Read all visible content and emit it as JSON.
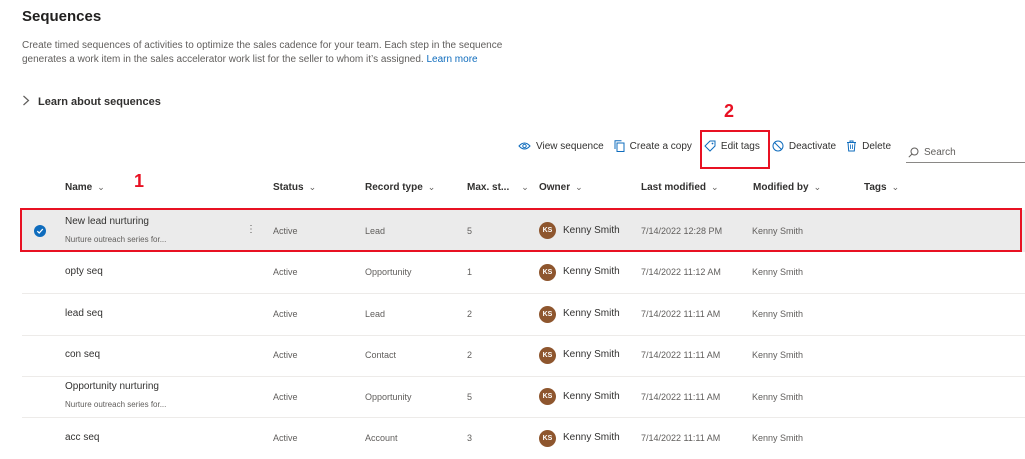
{
  "page": {
    "title": "Sequences",
    "description": "Create timed sequences of activities to optimize the sales cadence for your team. Each step in the sequence generates a work item in the sales accelerator work list for the seller to whom it’s assigned.",
    "learn_more": "Learn more",
    "learn_about": "Learn about sequences"
  },
  "toolbar": {
    "view_sequence": "View sequence",
    "create_copy": "Create a copy",
    "edit_tags": "Edit tags",
    "deactivate": "Deactivate",
    "delete": "Delete",
    "search_placeholder": "Search"
  },
  "columns": {
    "name": "Name",
    "status": "Status",
    "record_type": "Record type",
    "max_steps": "Max. st...",
    "owner": "Owner",
    "last_modified": "Last modified",
    "modified_by": "Modified by",
    "tags": "Tags"
  },
  "rows": [
    {
      "name": "New lead nurturing",
      "sub": "Nurture outreach series for...",
      "status": "Active",
      "record_type": "Lead",
      "max_steps": "5",
      "owner_initials": "KS",
      "owner": "Kenny Smith",
      "last_modified": "7/14/2022 12:28 PM",
      "modified_by": "Kenny Smith",
      "selected": true
    },
    {
      "name": "opty seq",
      "sub": "",
      "status": "Active",
      "record_type": "Opportunity",
      "max_steps": "1",
      "owner_initials": "KS",
      "owner": "Kenny Smith",
      "last_modified": "7/14/2022 11:12 AM",
      "modified_by": "Kenny Smith",
      "selected": false
    },
    {
      "name": "lead seq",
      "sub": "",
      "status": "Active",
      "record_type": "Lead",
      "max_steps": "2",
      "owner_initials": "KS",
      "owner": "Kenny Smith",
      "last_modified": "7/14/2022 11:11 AM",
      "modified_by": "Kenny Smith",
      "selected": false
    },
    {
      "name": "con seq",
      "sub": "",
      "status": "Active",
      "record_type": "Contact",
      "max_steps": "2",
      "owner_initials": "KS",
      "owner": "Kenny Smith",
      "last_modified": "7/14/2022 11:11 AM",
      "modified_by": "Kenny Smith",
      "selected": false
    },
    {
      "name": "Opportunity nurturing",
      "sub": "Nurture outreach series for...",
      "status": "Active",
      "record_type": "Opportunity",
      "max_steps": "5",
      "owner_initials": "KS",
      "owner": "Kenny Smith",
      "last_modified": "7/14/2022 11:11 AM",
      "modified_by": "Kenny Smith",
      "selected": false
    },
    {
      "name": "acc seq",
      "sub": "",
      "status": "Active",
      "record_type": "Account",
      "max_steps": "3",
      "owner_initials": "KS",
      "owner": "Kenny Smith",
      "last_modified": "7/14/2022 11:11 AM",
      "modified_by": "Kenny Smith",
      "selected": false
    }
  ],
  "annotations": {
    "step1": "1",
    "step2": "2"
  },
  "colors": {
    "accent": "#0f6cbd",
    "highlight": "#e81123",
    "avatar": "#8e562e"
  }
}
